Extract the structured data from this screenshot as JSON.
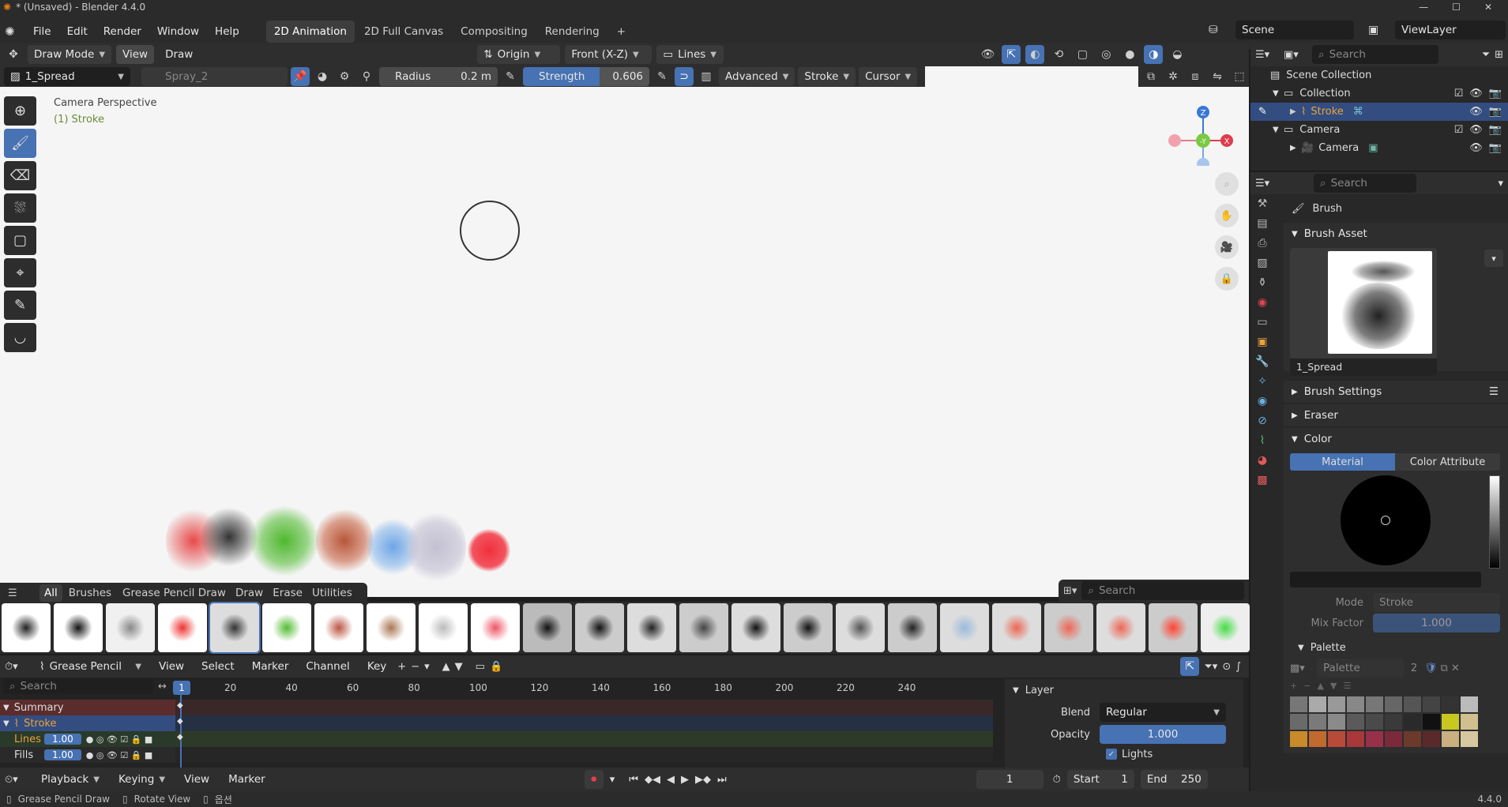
{
  "window": {
    "title": "* (Unsaved) - Blender 4.4.0"
  },
  "menu": [
    "File",
    "Edit",
    "Render",
    "Window",
    "Help"
  ],
  "workspaces": [
    {
      "label": "2D Animation",
      "active": true
    },
    {
      "label": "2D Full Canvas",
      "active": false
    },
    {
      "label": "Compositing",
      "active": false
    },
    {
      "label": "Rendering",
      "active": false
    }
  ],
  "scene": {
    "label": "Scene",
    "view_layer": "ViewLayer"
  },
  "header": {
    "mode": "Draw Mode",
    "view": "View",
    "draw": "Draw",
    "origin": "Origin",
    "orientation": "Front (X-Z)",
    "guide": "Lines"
  },
  "toolsettings": {
    "brush": "1_Spread",
    "secondary_brush": "Spray_2",
    "radius_label": "Radius",
    "radius_value": "0.2 m",
    "strength_label": "Strength",
    "strength_value": "0.606",
    "advanced": "Advanced",
    "stroke": "Stroke",
    "cursor": "Cursor"
  },
  "viewport": {
    "perspective": "Camera Perspective",
    "object": "(1) Stroke",
    "gizmo": {
      "z": "Z",
      "y": "-Y",
      "x": "X"
    }
  },
  "asset_shelf": {
    "tabs": [
      "All",
      "Brushes",
      "Grease Pencil Draw",
      "Draw",
      "Erase",
      "Utilities"
    ],
    "active_tab": "All",
    "search_placeholder": "Search"
  },
  "outliner": {
    "search_placeholder": "Search",
    "root": "Scene Collection",
    "items": [
      {
        "label": "Collection",
        "depth": 1
      },
      {
        "label": "Stroke",
        "depth": 2,
        "selected": true
      },
      {
        "label": "Camera",
        "depth": 1
      },
      {
        "label": "Camera",
        "depth": 2
      }
    ]
  },
  "properties": {
    "search_placeholder": "Search",
    "context": "Brush",
    "brush_asset_title": "Brush Asset",
    "brush_name": "1_Spread",
    "brush_settings": "Brush Settings",
    "eraser": "Eraser",
    "color": "Color",
    "color_tabs": [
      "Material",
      "Color Attribute"
    ],
    "mode_label": "Mode",
    "mode_value": "Stroke",
    "mix_factor_label": "Mix Factor",
    "mix_factor_value": "1.000",
    "palette_title": "Palette",
    "palette_name": "Palette",
    "palette_users": "2"
  },
  "timeline": {
    "editor": "Grease Pencil",
    "menus": [
      "View",
      "Select",
      "Marker",
      "Channel",
      "Key"
    ],
    "search_placeholder": "Search",
    "current_frame": "1",
    "ticks": [
      "20",
      "40",
      "60",
      "80",
      "100",
      "120",
      "140",
      "160",
      "180",
      "200",
      "220",
      "240"
    ],
    "channels": [
      {
        "label": "Summary"
      },
      {
        "label": "Stroke"
      },
      {
        "label": "Lines",
        "value": "1.00"
      },
      {
        "label": "Fills",
        "value": "1.00"
      }
    ],
    "layer_panel": {
      "title": "Layer",
      "blend_label": "Blend",
      "blend_value": "Regular",
      "opacity_label": "Opacity",
      "opacity_value": "1.000",
      "lights": "Lights"
    }
  },
  "playback": {
    "playback": "Playback",
    "keying": "Keying",
    "view": "View",
    "marker": "Marker",
    "frame": "1",
    "start_label": "Start",
    "start": "1",
    "end_label": "End",
    "end": "250"
  },
  "statusbar": {
    "left": "Grease Pencil Draw",
    "middle": "Rotate View",
    "right_hint": "옵션",
    "version": "4.4.0"
  },
  "colors": {
    "accent": "#4772b3",
    "selected_row": "#334d80",
    "stroke_orange": "#e8a33d"
  }
}
